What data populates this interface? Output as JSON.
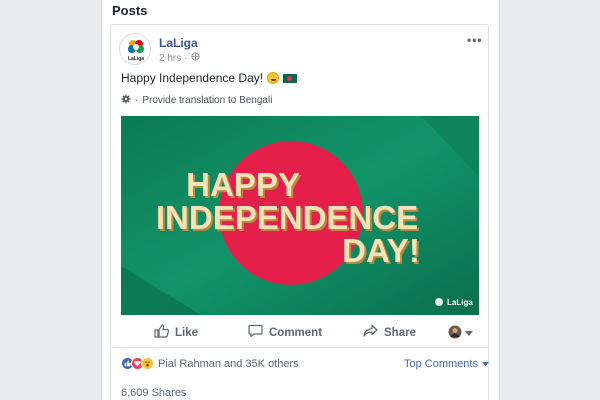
{
  "section_title": "Posts",
  "post": {
    "author": "LaLiga",
    "avatar_text": "LaLiga",
    "time": "2 hrs",
    "privacy_icon": "globe-icon",
    "text": "Happy Independence Day!",
    "translate_link": "Provide translation to Bengali",
    "media": {
      "line1": "HAPPY",
      "line2": "INDEPENDENCE",
      "line3": "DAY!",
      "watermark": "LaLiga",
      "colors": {
        "background": "#0f8c63",
        "circle": "#e4204a",
        "text": "#f3e2b8",
        "shadow": "#b98a3d"
      }
    },
    "actions": {
      "like": "Like",
      "comment": "Comment",
      "share": "Share"
    },
    "reactions_text": "Pial Rahman and 35K others",
    "top_comments": "Top Comments",
    "shares": "6,609 Shares"
  },
  "colors": {
    "link": "#365899",
    "accent": "#4267b2",
    "muted": "#606770"
  }
}
